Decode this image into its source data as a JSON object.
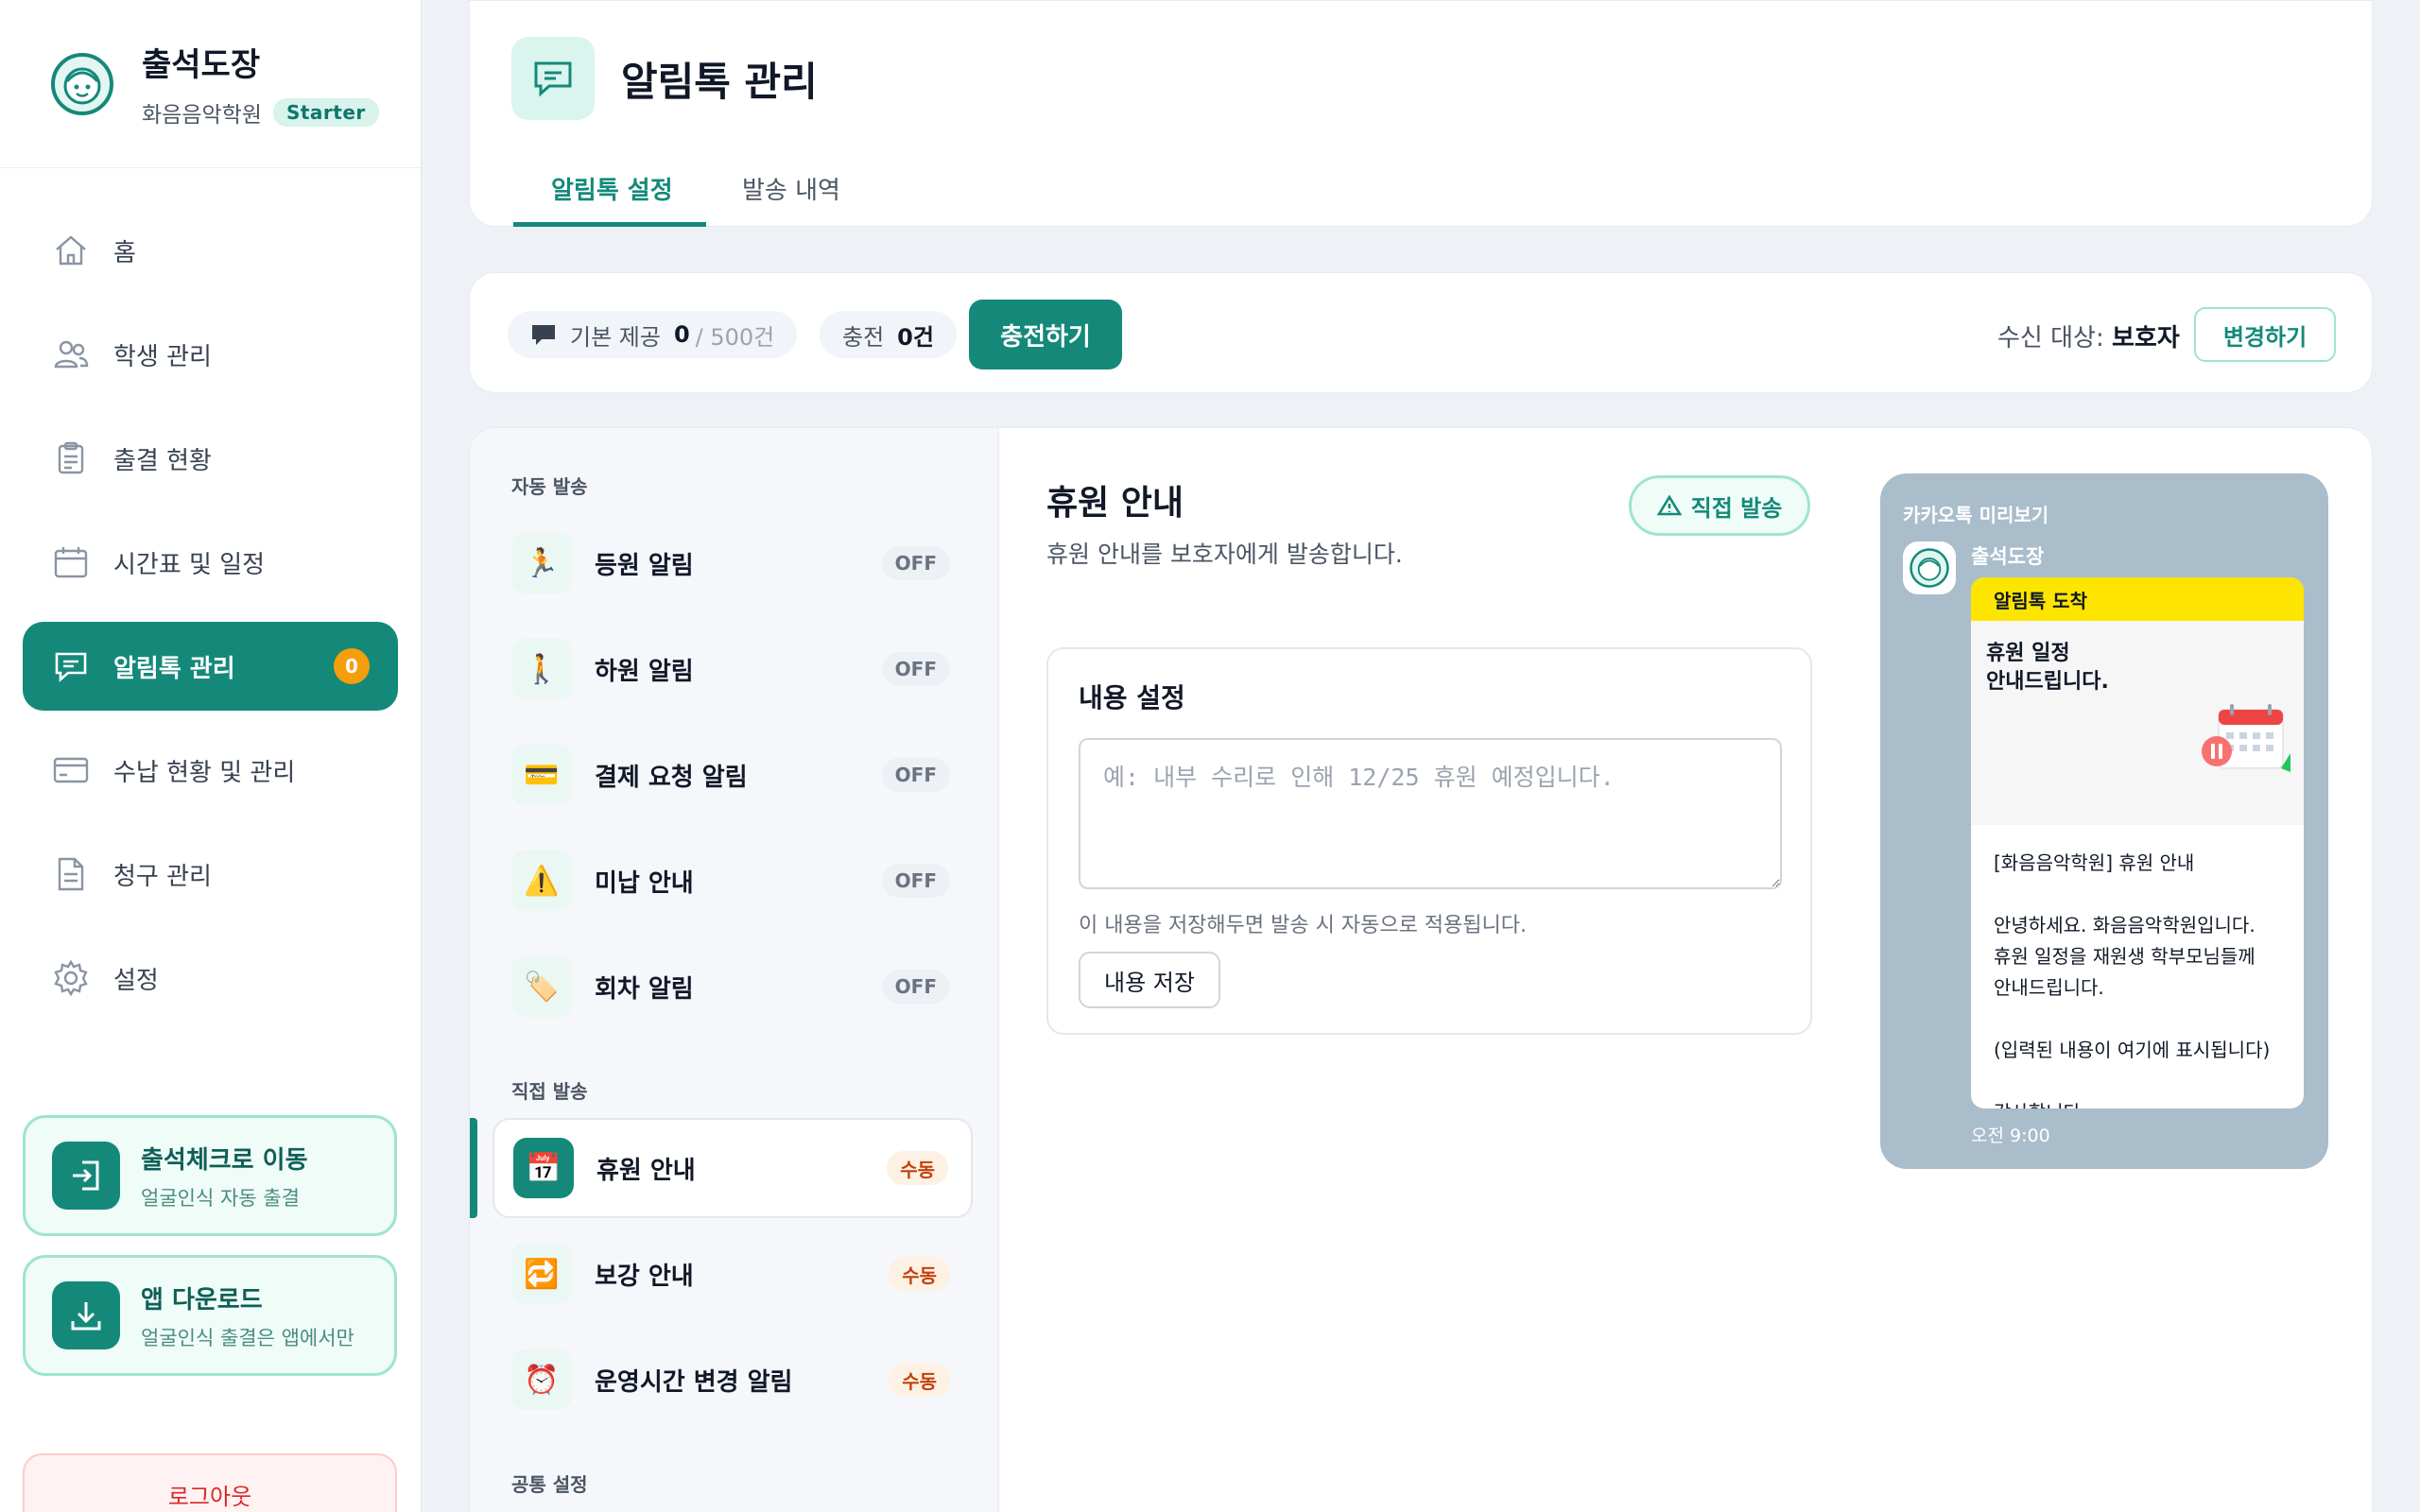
{
  "brand": {
    "name": "출석도장",
    "academy": "화음음악학원",
    "plan": "Starter"
  },
  "nav": {
    "items": [
      {
        "label": "홈",
        "icon": "home-icon"
      },
      {
        "label": "학생 관리",
        "icon": "users-icon"
      },
      {
        "label": "출결 현황",
        "icon": "clipboard-icon"
      },
      {
        "label": "시간표 및 일정",
        "icon": "calendar-icon"
      },
      {
        "label": "알림톡 관리",
        "icon": "chat-icon",
        "active": true,
        "badge": "0"
      },
      {
        "label": "수납 현황 및 관리",
        "icon": "card-icon"
      },
      {
        "label": "청구 관리",
        "icon": "document-icon"
      },
      {
        "label": "설정",
        "icon": "gear-icon"
      }
    ]
  },
  "side_cards": {
    "checkin": {
      "title": "출석체크로 이동",
      "sub": "얼굴인식 자동 출결"
    },
    "download": {
      "title": "앱 다운로드",
      "sub": "얼굴인식 출결은 앱에서만"
    }
  },
  "logout_label": "로그아웃",
  "header": {
    "title": "알림톡 관리",
    "tabs": [
      {
        "label": "알림톡 설정",
        "active": true
      },
      {
        "label": "발송 내역"
      }
    ]
  },
  "status": {
    "base_label": "기본 제공",
    "base_used": "0",
    "base_total": "/ 500건",
    "charge_label": "충전",
    "charge_value": "0건",
    "charge_button": "충전하기",
    "recipient_label": "수신 대상:",
    "recipient_value": "보호자",
    "change_button": "변경하기"
  },
  "sections": {
    "auto": "자동 발송",
    "manual": "직접 발송",
    "common": "공통 설정"
  },
  "auto_items": [
    {
      "label": "등원 알림",
      "tag": "OFF",
      "icon": "running-person-icon"
    },
    {
      "label": "하원 알림",
      "tag": "OFF",
      "icon": "walking-person-icon"
    },
    {
      "label": "결제 요청 알림",
      "tag": "OFF",
      "icon": "credit-card-icon"
    },
    {
      "label": "미납 안내",
      "tag": "OFF",
      "icon": "warning-icon"
    },
    {
      "label": "회차 알림",
      "tag": "OFF",
      "icon": "ticket-icon"
    }
  ],
  "manual_items": [
    {
      "label": "휴원 안내",
      "tag": "수동",
      "icon": "calendar-17-icon",
      "selected": true
    },
    {
      "label": "보강 안내",
      "tag": "수동",
      "icon": "repeat-icon"
    },
    {
      "label": "운영시간 변경 알림",
      "tag": "수동",
      "icon": "alarm-clock-icon"
    }
  ],
  "detail": {
    "title": "휴원 안내",
    "description": "휴원 안내를 보호자에게 발송합니다.",
    "direct_send": "직접 발송",
    "content_title": "내용 설정",
    "placeholder": "예: 내부 수리로 인해 12/25 휴원 예정입니다.",
    "hint": "이 내용을 저장해두면 발송 시 자동으로 적용됩니다.",
    "save_button": "내용 저장"
  },
  "preview": {
    "label": "카카오톡 미리보기",
    "sender": "출석도장",
    "header": "알림톡 도착",
    "hero_line1": "휴원 일정",
    "hero_line2": "안내드립니다.",
    "body": [
      "[화음음악학원] 휴원 안내",
      "안녕하세요. 화음음악학원입니다.\n휴원 일정을 재원생 학부모님들께\n안내드립니다.",
      "(입력된 내용이 여기에 표시됩니다)",
      "감사합니다."
    ],
    "time": "오전 9:00"
  },
  "colors": {
    "primary": "#14897a",
    "badge": "#f59e0b",
    "kakao_bg": "#a9bdcb",
    "kakao_yellow": "#fde500"
  }
}
